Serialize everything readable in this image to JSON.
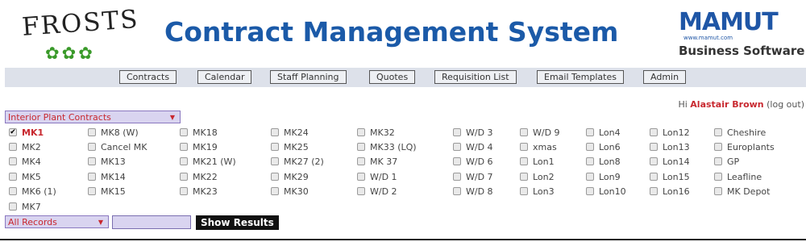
{
  "header": {
    "logo_left_text": "FROSTS",
    "logo_left_leaves": "✿✿✿",
    "title": "Contract Management System",
    "logo_right_text": "MAMUT",
    "logo_right_url": "www.mamut.com",
    "logo_right_sub": "Business Software"
  },
  "nav": [
    "Contracts",
    "Calendar",
    "Staff Planning",
    "Quotes",
    "Requisition List",
    "Email Templates",
    "Admin"
  ],
  "user": {
    "greeting": "Hi",
    "name": "Alastair Brown",
    "logout": "(log out)"
  },
  "filters": {
    "contract_type": "Interior Plant Contracts",
    "records": "All Records",
    "search_value": "",
    "show_results": "Show Results"
  },
  "checkboxes": [
    [
      {
        "label": "MK1",
        "checked": true
      },
      {
        "label": "MK2"
      },
      {
        "label": "MK4"
      },
      {
        "label": "MK5"
      },
      {
        "label": "MK6 (1)"
      },
      {
        "label": "MK7"
      }
    ],
    [
      {
        "label": "MK8 (W)"
      },
      {
        "label": "Cancel MK"
      },
      {
        "label": "MK13"
      },
      {
        "label": "MK14"
      },
      {
        "label": "MK15"
      }
    ],
    [
      {
        "label": "MK18"
      },
      {
        "label": "MK19"
      },
      {
        "label": "MK21 (W)"
      },
      {
        "label": "MK22"
      },
      {
        "label": "MK23"
      }
    ],
    [
      {
        "label": "MK24"
      },
      {
        "label": "MK25"
      },
      {
        "label": "MK27 (2)"
      },
      {
        "label": "MK29"
      },
      {
        "label": "MK30"
      }
    ],
    [
      {
        "label": "MK32"
      },
      {
        "label": "MK33 (LQ)"
      },
      {
        "label": "MK 37"
      },
      {
        "label": "W/D 1"
      },
      {
        "label": "W/D 2"
      }
    ],
    [
      {
        "label": "W/D 3"
      },
      {
        "label": "W/D 4"
      },
      {
        "label": "W/D 6"
      },
      {
        "label": "W/D 7"
      },
      {
        "label": "W/D 8"
      }
    ],
    [
      {
        "label": "W/D 9"
      },
      {
        "label": "xmas"
      },
      {
        "label": "Lon1"
      },
      {
        "label": "Lon2"
      },
      {
        "label": "Lon3"
      }
    ],
    [
      {
        "label": "Lon4"
      },
      {
        "label": "Lon6"
      },
      {
        "label": "Lon8"
      },
      {
        "label": "Lon9"
      },
      {
        "label": "Lon10"
      }
    ],
    [
      {
        "label": "Lon12"
      },
      {
        "label": "Lon13"
      },
      {
        "label": "Lon14"
      },
      {
        "label": "Lon15"
      },
      {
        "label": "Lon16"
      }
    ],
    [
      {
        "label": "Cheshire"
      },
      {
        "label": "Europlants"
      },
      {
        "label": "GP"
      },
      {
        "label": "Leafline"
      },
      {
        "label": "MK Depot"
      }
    ]
  ],
  "colors": {
    "accent_red": "#c8282f",
    "title_blue": "#1b5aa8",
    "nav_bg": "#dde1ea",
    "select_bg": "#d9d4f0"
  }
}
